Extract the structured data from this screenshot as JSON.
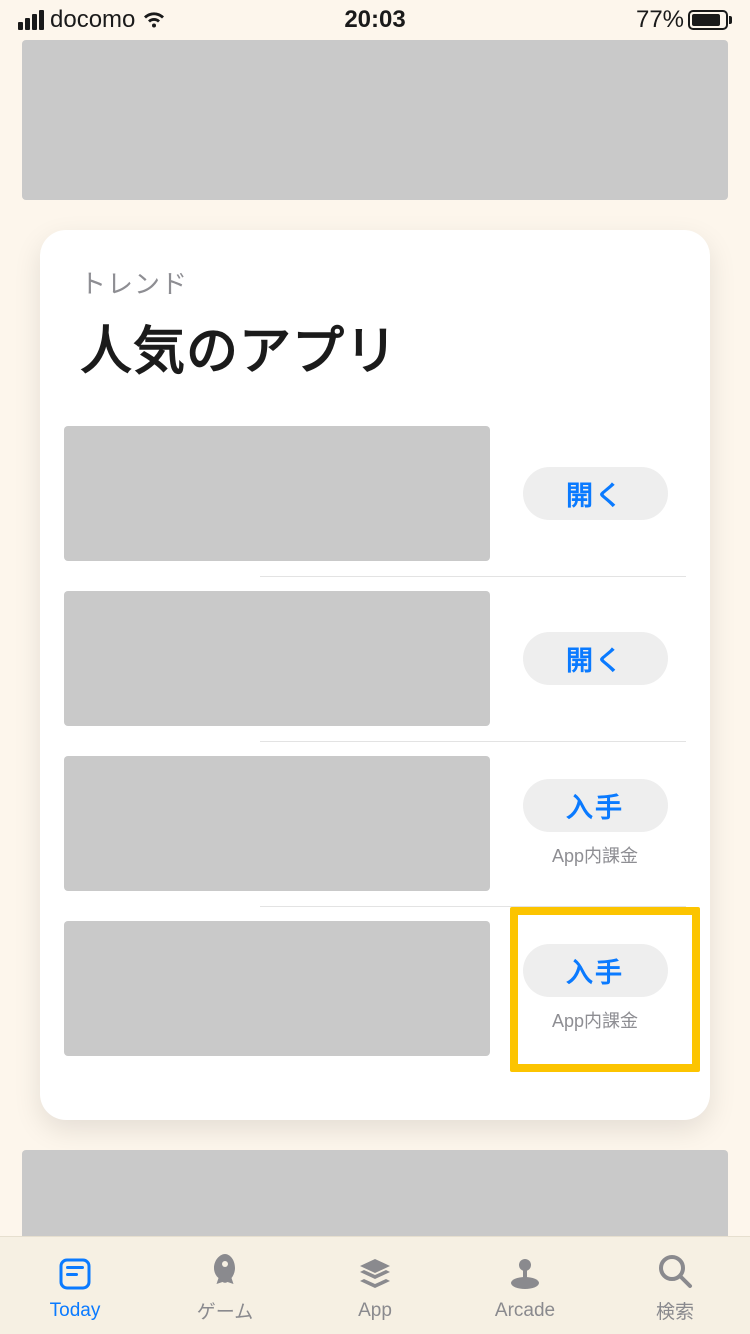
{
  "status": {
    "carrier": "docomo",
    "time": "20:03",
    "battery_pct": "77%"
  },
  "card": {
    "subtitle": "トレンド",
    "title": "人気のアプリ",
    "rows": [
      {
        "button": "開く",
        "iap": ""
      },
      {
        "button": "開く",
        "iap": ""
      },
      {
        "button": "入手",
        "iap": "App内課金"
      },
      {
        "button": "入手",
        "iap": "App内課金"
      }
    ]
  },
  "tabs": {
    "today": "Today",
    "games": "ゲーム",
    "apps": "App",
    "arcade": "Arcade",
    "search": "検索"
  }
}
